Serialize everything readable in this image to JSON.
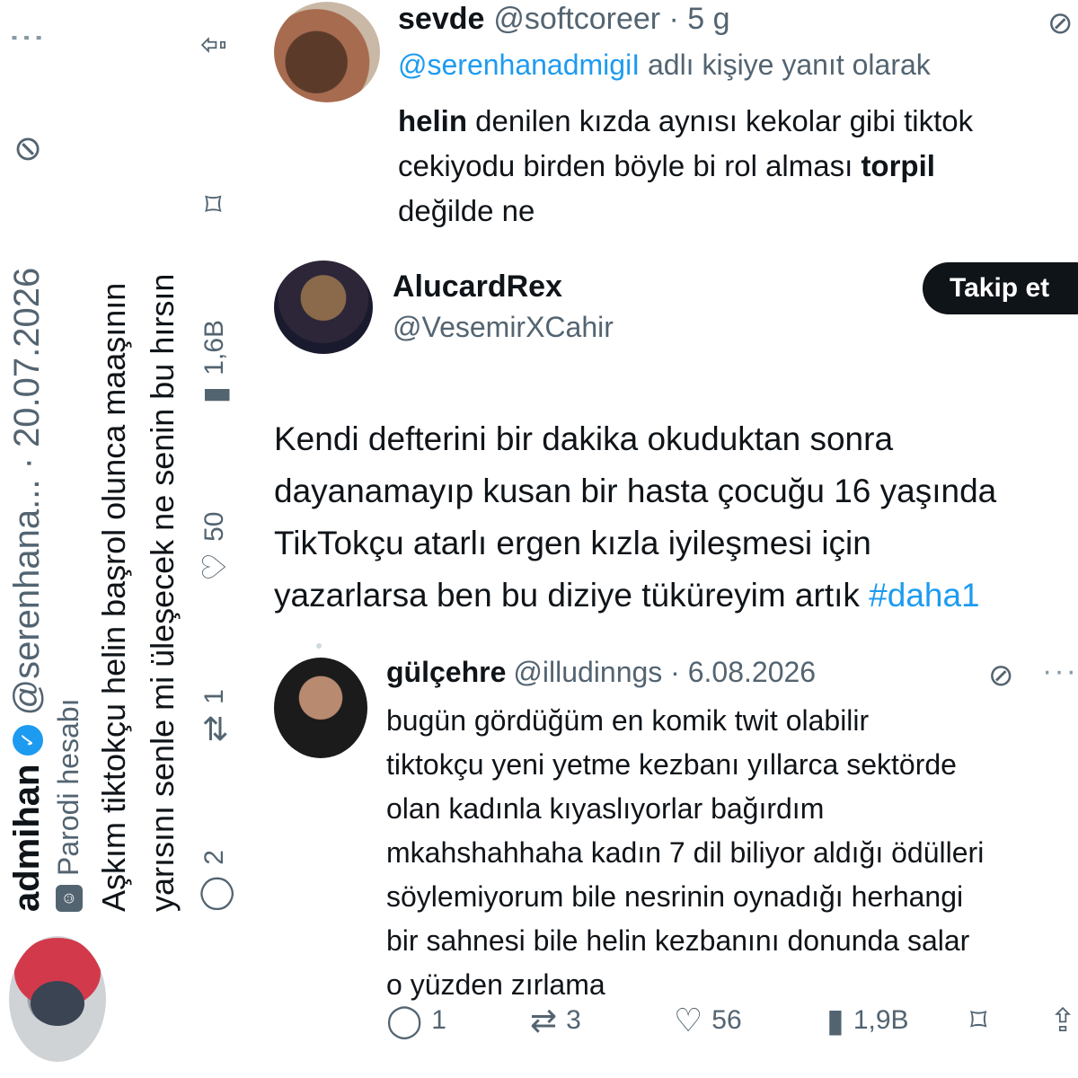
{
  "left_tweet": {
    "display_name": "admihan",
    "handle_date": "@serenhana... · 20.07.2026",
    "parody_label": "Parodi hesabı",
    "text_lines": [
      "Aşkım tiktokçu helin başrol olunca maaşının",
      "yarısını senle mi üleşecek ne senin bu hırsın"
    ],
    "replies": "2",
    "reposts": "1",
    "likes": "50",
    "views": "1,6B"
  },
  "tweet1": {
    "display_name": "sevde",
    "handle_time": "@softcoreer · 5 g",
    "reply_mention": "@serenhanadmigiI",
    "reply_suffix": "adlı kişiye yanıt olarak",
    "line1_bold": "helin",
    "line1_rest": " denilen kızda aynısı kekolar gibi tiktok",
    "line2_start": "cekiyodu birden böyle bi rol alması ",
    "line2_bold": "torpil",
    "line3": "değilde ne"
  },
  "tweet2": {
    "display_name": "AlucardRex",
    "handle": "@VesemirXCahir",
    "follow_label": "Takip et",
    "lines": [
      "Kendi defterini bir dakika okuduktan sonra",
      "dayanamayıp kusan bir hasta çocuğu 16 yaşında",
      "TikTokçu atarlı ergen kızla iyileşmesi için"
    ],
    "line4_text": "yazarlarsa ben bu diziye tüküreyim artık ",
    "line4_hashtag": "#daha1"
  },
  "tweet3": {
    "display_name": "gülçehre",
    "handle_date": "@illudinngs · 6.08.2026",
    "lines": [
      "bugün gördüğüm en komik twit olabilir",
      "tiktokçu yeni yetme kezbanı yıllarca sektörde",
      "olan kadınla kıyaslıyorlar bağırdım",
      "mkahshahhaha kadın 7 dil biliyor aldığı ödülleri",
      "söylemiyorum bile nesrinin oynadığı herhangi",
      "bir sahnesi bile helin kezbanını  donunda salar",
      "o yüzden zırlama"
    ],
    "replies": "1",
    "reposts": "3",
    "likes": "56",
    "views": "1,9B"
  },
  "icons": {
    "reply": "reply-icon",
    "repost": "repost-icon",
    "like": "heart-icon",
    "views": "views-icon",
    "bookmark": "bookmark-icon",
    "share": "share-icon",
    "grok": "grok-icon",
    "more": "more-icon"
  },
  "colors": {
    "accent": "#1d9bf0",
    "text": "#0f1419",
    "muted": "#536471"
  }
}
